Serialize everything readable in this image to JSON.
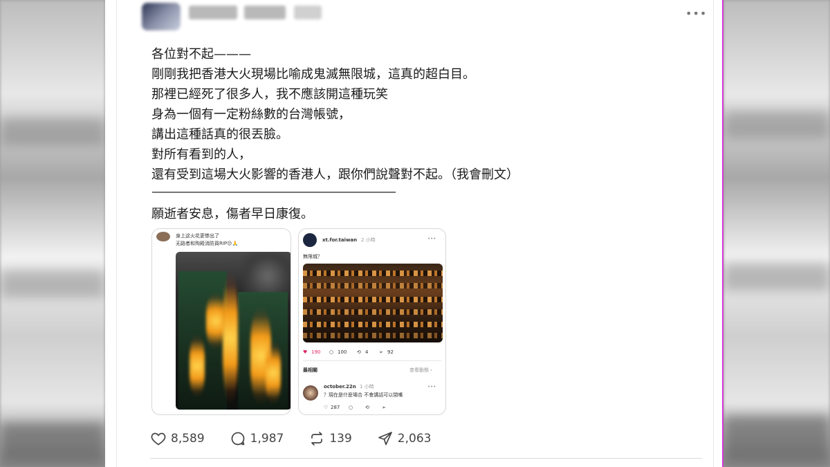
{
  "post": {
    "lines": [
      "各位對不起———",
      "剛剛我把香港大火現場比喻成鬼滅無限城，這真的超白目。",
      "那裡已經死了很多人，我不應該開這種玩笑",
      "身為一個有一定粉絲數的台灣帳號，",
      "講出這種話真的很丟臉。",
      "對所有看到的人，",
      "還有受到這場大火影響的香港人，跟你們說聲對不起。（我會刪文）",
      "——————————————————————",
      "願逝者安息，傷者早日康復。"
    ]
  },
  "embedded": {
    "left": {
      "caption_1": "身上这火花更惨出了",
      "caption_2": "无路者和殉殿消防員RIP😔🙏"
    },
    "right": {
      "username": "xt.for.taiwan",
      "time": "2 小時",
      "caption": "無限城？",
      "likes": "190",
      "replies": "100",
      "reposts": "4",
      "shares": "92",
      "sort_label": "最相關",
      "view_activity": "查看動態 ›",
      "reply_user": "october.22n",
      "reply_time": "1 小時",
      "reply_text": "？現在是什麼場合 不會講話可以閉嘴",
      "reply_likes": "287"
    }
  },
  "actions": {
    "likes": "8,589",
    "comments": "1,987",
    "reposts": "139",
    "shares": "2,063"
  },
  "colors": {
    "heart_red": "#e0245e",
    "accent_magenta": "#d23bd8",
    "text_gray": "#444444"
  },
  "icons": [
    "more-icon",
    "heart-icon",
    "comment-icon",
    "repost-icon",
    "share-icon"
  ]
}
